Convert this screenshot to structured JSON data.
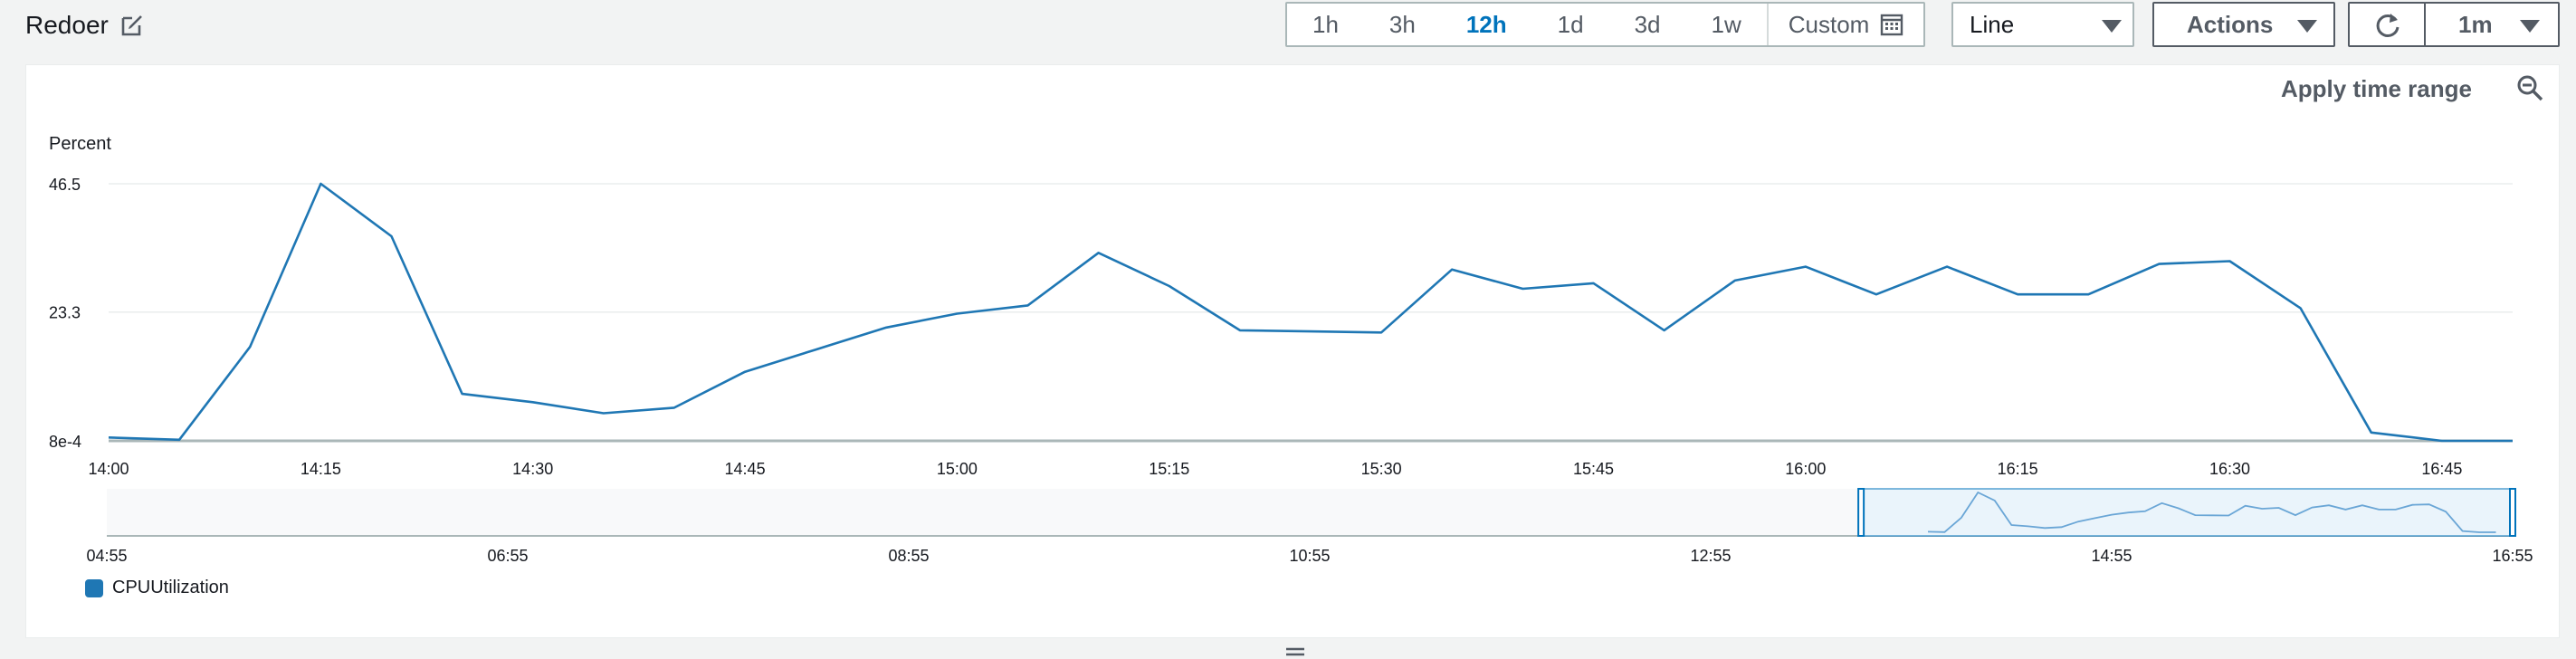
{
  "header": {
    "title": "Redoer",
    "time_ranges": [
      "1h",
      "3h",
      "12h",
      "1d",
      "3d",
      "1w"
    ],
    "active_range": "12h",
    "custom_label": "Custom",
    "chart_type_value": "Line",
    "actions_label": "Actions",
    "refresh_interval": "1m"
  },
  "panel": {
    "apply_label": "Apply time range"
  },
  "colors": {
    "series": "#1f77b4",
    "active": "#0073bb",
    "grid": "#eaeded"
  },
  "chart_data": {
    "type": "line",
    "ylabel": "Percent",
    "yticks": [
      "8e-4",
      "23.3",
      "46.5"
    ],
    "ytick_values": [
      0.0008,
      23.3,
      46.5
    ],
    "ylim": [
      0.0008,
      46.5
    ],
    "x_start": "14:00",
    "x_end": "16:50",
    "xticks": [
      "14:00",
      "14:15",
      "14:30",
      "14:45",
      "15:00",
      "15:15",
      "15:30",
      "15:45",
      "16:00",
      "16:15",
      "16:30",
      "16:45"
    ],
    "series": [
      {
        "name": "CPUUtilization",
        "x": [
          "14:00",
          "14:05",
          "14:10",
          "14:15",
          "14:20",
          "14:25",
          "14:30",
          "14:35",
          "14:40",
          "14:45",
          "14:50",
          "14:55",
          "15:00",
          "15:05",
          "15:10",
          "15:15",
          "15:20",
          "15:25",
          "15:30",
          "15:35",
          "15:40",
          "15:45",
          "15:50",
          "15:55",
          "16:00",
          "16:05",
          "16:10",
          "16:15",
          "16:20",
          "16:25",
          "16:30",
          "16:35",
          "16:40",
          "16:45",
          "16:50"
        ],
        "values": [
          0.6,
          0.2,
          17.0,
          46.5,
          37.0,
          8.5,
          7.0,
          5.0,
          6.0,
          12.5,
          16.5,
          20.5,
          23.0,
          24.5,
          34.0,
          28.0,
          20.0,
          19.8,
          19.6,
          31.0,
          27.5,
          28.5,
          20.0,
          29.0,
          31.5,
          26.5,
          31.5,
          26.5,
          26.5,
          32.0,
          32.5,
          24.0,
          1.5,
          0.0008,
          0.0008
        ]
      }
    ],
    "overview": {
      "xticks": [
        "04:55",
        "06:55",
        "08:55",
        "10:55",
        "12:55",
        "14:55",
        "16:55"
      ]
    },
    "legend_position": "bottom-left",
    "grid": true
  }
}
